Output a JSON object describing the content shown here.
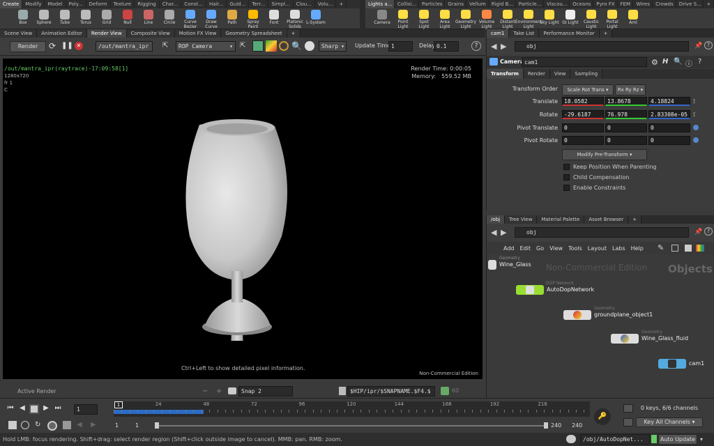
{
  "shelf_left": {
    "tabs": [
      "Create",
      "Modify",
      "Model",
      "Poly...",
      "Deform",
      "Texture",
      "Rigging",
      "Char...",
      "Const...",
      "Hair...",
      "Guid...",
      "Terr...",
      "Simpl...",
      "Clou...",
      "Volu..."
    ],
    "tools": [
      {
        "label": "Box",
        "icon": "box-icon",
        "color": "#9aa"
      },
      {
        "label": "Sphere",
        "icon": "sphere-icon",
        "color": "#bbb"
      },
      {
        "label": "Tube",
        "icon": "tube-icon",
        "color": "#bbb"
      },
      {
        "label": "Torus",
        "icon": "torus-icon",
        "color": "#bbb"
      },
      {
        "label": "Grid",
        "icon": "grid-icon",
        "color": "#aaa"
      },
      {
        "label": "Null",
        "icon": "null-icon",
        "color": "#c44"
      },
      {
        "label": "Line",
        "icon": "line-icon",
        "color": "#c66"
      },
      {
        "label": "Circle",
        "icon": "circle-icon",
        "color": "#aaa"
      },
      {
        "label": "Curve Bezier",
        "icon": "curve-bezier-icon",
        "color": "#6af"
      },
      {
        "label": "Draw Curve",
        "icon": "draw-curve-icon",
        "color": "#6af"
      },
      {
        "label": "Path",
        "icon": "path-icon",
        "color": "#da4"
      },
      {
        "label": "Spray Paint",
        "icon": "spray-paint-icon",
        "color": "#fb0"
      },
      {
        "label": "Font",
        "icon": "font-icon",
        "color": "#ddd"
      },
      {
        "label": "Platonic Solids",
        "icon": "platonic-icon",
        "color": "#ddd"
      },
      {
        "label": "L-System",
        "icon": "lsystem-icon",
        "color": "#6af"
      }
    ]
  },
  "shelf_right": {
    "tabs": [
      "Lights a...",
      "Collisi...",
      "Particles",
      "Grains",
      "Vellum",
      "Rigid B...",
      "Particle...",
      "Viscou...",
      "Oceans",
      "Pyro FX",
      "FEM",
      "Wires",
      "Crowds",
      "Drive S..."
    ],
    "tools": [
      {
        "label": "Camera",
        "icon": "camera-icon",
        "color": "#888"
      },
      {
        "label": "Point Light",
        "icon": "point-light-icon",
        "color": "#fd4"
      },
      {
        "label": "Spot Light",
        "icon": "spot-light-icon",
        "color": "#fd4"
      },
      {
        "label": "Area Light",
        "icon": "area-light-icon",
        "color": "#fd4"
      },
      {
        "label": "Geometry Light",
        "icon": "geometry-light-icon",
        "color": "#fd4"
      },
      {
        "label": "Volume Light",
        "icon": "volume-light-icon",
        "color": "#f84"
      },
      {
        "label": "Distant Light",
        "icon": "distant-light-icon",
        "color": "#fd4"
      },
      {
        "label": "Environment Light",
        "icon": "env-light-icon",
        "color": "#fd4"
      },
      {
        "label": "Sky Light",
        "icon": "sky-light-icon",
        "color": "#fd4"
      },
      {
        "label": "GI Light",
        "icon": "gi-light-icon",
        "color": "#eee"
      },
      {
        "label": "Caustic Light",
        "icon": "caustic-light-icon",
        "color": "#fd4"
      },
      {
        "label": "Portal Light",
        "icon": "portal-light-icon",
        "color": "#fd4"
      },
      {
        "label": "Aml",
        "icon": "ambient-light-icon",
        "color": "#fd4"
      }
    ]
  },
  "pane_tabs_left": [
    "Scene View",
    "Animation Editor",
    "Render View",
    "Composite View",
    "Motion FX View",
    "Geometry Spreadsheet"
  ],
  "render_toolbar": {
    "render_label": "Render",
    "output_path": "/out/mantra_ipr",
    "camera": "ROP Camera",
    "sharp": "Sharp",
    "update_time_label": "Update Time",
    "update_time_value": "1",
    "delay_label": "Delay",
    "delay_value": "0.1"
  },
  "viewport": {
    "render_path": "/out/mantra_ipr(raytrace)-17:09:58[1]",
    "resolution": "1280x720",
    "frame": "fr 1",
    "channel": "C",
    "render_time": "Render Time: 0:00:05",
    "memory_label": "Memory:",
    "memory_value": "559.52 MB",
    "hint": "Ctrl+Left to show detailed pixel information.",
    "edition": "Non-Commercial Edition"
  },
  "status_row": {
    "active_render": "Active Render",
    "snap_label": "Snap 2",
    "snap_path": "$HIP/ipr/$SNAPNAME.$F4.$",
    "snap_num": "60"
  },
  "param_pane": {
    "tabs": [
      "cam1",
      "Take List",
      "Performance Monitor"
    ],
    "path": "obj",
    "node_type": "Camera",
    "node_name": "cam1",
    "sub_tabs": [
      "Transform",
      "Render",
      "View",
      "Sampling"
    ],
    "transform_order_label": "Transform Order",
    "transform_order_value": "Scale Rot Trans",
    "rot_order_value": "Rx Ry Rz",
    "translate_label": "Translate",
    "translate": [
      "18.0582",
      "13.8678",
      "4.18824"
    ],
    "rotate_label": "Rotate",
    "rotate": [
      "-29.6187",
      "76.978",
      "2.83308e-05"
    ],
    "pivot_translate_label": "Pivot Translate",
    "pivot_translate": [
      "0",
      "0",
      "0"
    ],
    "pivot_rotate_label": "Pivot Rotate",
    "pivot_rotate": [
      "0",
      "0",
      "0"
    ],
    "modify_pretransform": "Modify Pre-Transform",
    "checkboxes": [
      "Keep Position When Parenting",
      "Child Compensation",
      "Enable Constraints"
    ]
  },
  "network_pane": {
    "tabs": [
      "/obj",
      "Tree View",
      "Material Palette",
      "Asset Browser"
    ],
    "path": "obj",
    "menu": [
      "Add",
      "Edit",
      "Go",
      "View",
      "Tools",
      "Layout",
      "Labs",
      "Help"
    ],
    "watermark": "Non-Commercial Edition",
    "context_label": "Objects",
    "nodes": [
      {
        "type": "Geometry",
        "name": "Wine_Glass"
      },
      {
        "type": "DOP Network",
        "name": "AutoDopNetwork"
      },
      {
        "type": "Geometry",
        "name": "groundplane_object1"
      },
      {
        "type": "Geometry",
        "name": "Wine_Glass_fluid"
      },
      {
        "type": "",
        "name": "cam1"
      }
    ]
  },
  "timeline": {
    "frame_input": "1",
    "ticks": [
      "1",
      "24",
      "48",
      "72",
      "96",
      "120",
      "144",
      "168",
      "192",
      "216"
    ],
    "range_start": "1",
    "range_start2": "1",
    "range_end": "240",
    "range_end2": "240",
    "keys_info": "0 keys, 6/6 channels",
    "key_all": "Key All Channels"
  },
  "statusbar": {
    "message": "Hold LMB: focus rendering. Shift+drag: select render region (Shift+click outside image to cancel). MMB: pan. RMB: zoom.",
    "path": "/obj/AutoDopNet...",
    "update_mode": "Auto Update"
  }
}
